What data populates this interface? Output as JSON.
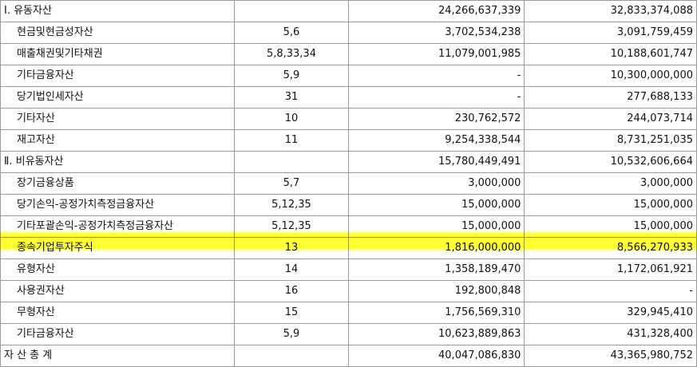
{
  "rows": [
    {
      "name": "Ⅰ. 유동자산",
      "note": "",
      "v1": "24,266,637,339",
      "v2": "32,833,374,088",
      "level": 1
    },
    {
      "name": "현금및현금성자산",
      "note": "5,6",
      "v1": "3,702,534,238",
      "v2": "3,091,759,459",
      "level": 2
    },
    {
      "name": "매출채권및기타채권",
      "note": "5,8,33,34",
      "v1": "11,079,001,985",
      "v2": "10,188,601,747",
      "level": 2
    },
    {
      "name": "기타금융자산",
      "note": "5,9",
      "v1": "-",
      "v2": "10,300,000,000",
      "level": 2
    },
    {
      "name": "당기법인세자산",
      "note": "31",
      "v1": "-",
      "v2": "277,688,133",
      "level": 2
    },
    {
      "name": "기타자산",
      "note": "10",
      "v1": "230,762,572",
      "v2": "244,073,714",
      "level": 2
    },
    {
      "name": "재고자산",
      "note": "11",
      "v1": "9,254,338,544",
      "v2": "8,731,251,035",
      "level": 2
    },
    {
      "name": "Ⅱ. 비유동자산",
      "note": "",
      "v1": "15,780,449,491",
      "v2": "10,532,606,664",
      "level": 1
    },
    {
      "name": "장기금융상품",
      "note": "5,7",
      "v1": "3,000,000",
      "v2": "3,000,000",
      "level": 2
    },
    {
      "name": "당기손익-공정가치측정금융자산",
      "note": "5,12,35",
      "v1": "15,000,000",
      "v2": "15,000,000",
      "level": 2
    },
    {
      "name": "기타포괄손익-공정가치측정금융자산",
      "note": "5,12,35",
      "v1": "15,000,000",
      "v2": "15,000,000",
      "level": 2
    },
    {
      "name": "종속기업투자주식",
      "note": "13",
      "v1": "1,816,000,000",
      "v2": "8,566,270,933",
      "level": 2
    },
    {
      "name": "유형자산",
      "note": "14",
      "v1": "1,358,189,470",
      "v2": "1,172,061,921",
      "level": 2
    },
    {
      "name": "사용권자산",
      "note": "16",
      "v1": "192,800,848",
      "v2": "-",
      "level": 2
    },
    {
      "name": "무형자산",
      "note": "15",
      "v1": "1,756,569,310",
      "v2": "329,945,410",
      "level": 2
    },
    {
      "name": "기타금융자산",
      "note": "5,9",
      "v1": "10,623,889,863",
      "v2": "431,328,400",
      "level": 2
    },
    {
      "name": "자  산  총  계",
      "note": "",
      "v1": "40,047,086,830",
      "v2": "43,365,980,752",
      "level": 1
    }
  ]
}
